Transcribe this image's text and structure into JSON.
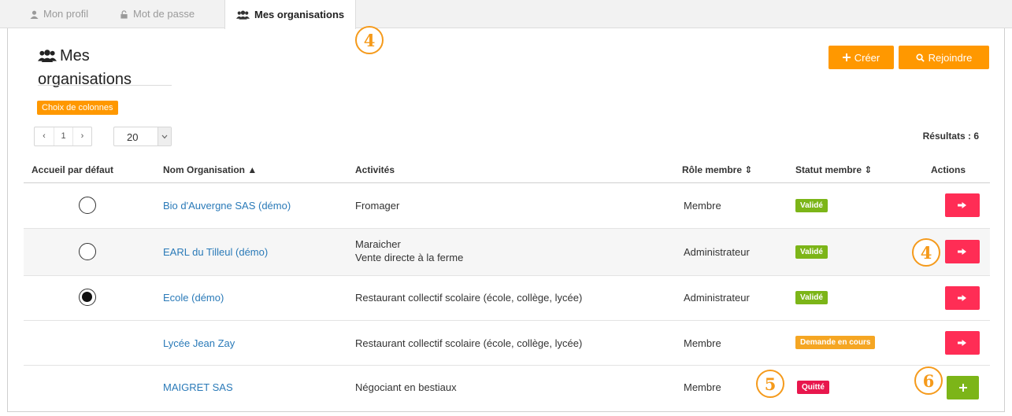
{
  "tabs": [
    {
      "label": "Mon profil",
      "icon": "user-icon",
      "active": false
    },
    {
      "label": "Mot de passe",
      "icon": "lock-icon",
      "active": false
    },
    {
      "label": "Mes organisations",
      "icon": "users-icon",
      "active": true
    }
  ],
  "page": {
    "title_line1": "Mes",
    "title_line2": "organisations",
    "create_label": "Créer",
    "join_label": "Rejoindre",
    "columns_label": "Choix de colonnes"
  },
  "pagination": {
    "prev": "‹",
    "current": "1",
    "next": "›",
    "page_size": "20",
    "results": "Résultats : 6"
  },
  "table": {
    "headers": {
      "default_home": "Accueil par défaut",
      "name": "Nom Organisation ▲",
      "activities": "Activités",
      "role": "Rôle membre ⇕",
      "status": "Statut membre ⇕",
      "actions": "Actions"
    },
    "rows": [
      {
        "name": "Bio d'Auvergne SAS (démo)",
        "activity1": "Fromager",
        "activity2": "",
        "role": "Membre",
        "status": "Validé",
        "status_color": "#7cb518",
        "has_radio": true,
        "radio_selected": false,
        "action": "leave"
      },
      {
        "name": "EARL du Tilleul (démo)",
        "activity1": "Maraicher",
        "activity2": "Vente directe à la ferme",
        "role": "Administrateur",
        "status": "Validé",
        "status_color": "#7cb518",
        "has_radio": true,
        "radio_selected": false,
        "action": "leave"
      },
      {
        "name": "Ecole (démo)",
        "activity1": "Restaurant collectif scolaire (école, collège, lycée)",
        "activity2": "",
        "role": "Administrateur",
        "status": "Validé",
        "status_color": "#7cb518",
        "has_radio": true,
        "radio_selected": true,
        "action": "leave"
      },
      {
        "name": "Lycée Jean Zay",
        "activity1": "Restaurant collectif scolaire (école, collège, lycée)",
        "activity2": "",
        "role": "Membre",
        "status": "Demande en cours",
        "status_color": "#f5a623",
        "has_radio": false,
        "radio_selected": false,
        "action": "leave"
      },
      {
        "name": "MAIGRET SAS",
        "activity1": "Négociant en bestiaux",
        "activity2": "",
        "role": "Membre",
        "status": "Quitté",
        "status_color": "#e8174d",
        "has_radio": false,
        "radio_selected": false,
        "action": "add"
      }
    ]
  },
  "annotations": {
    "tab_marker": "4",
    "row_action_marker": "4",
    "status_marker": "5",
    "add_marker": "6"
  },
  "colors": {
    "accent_orange": "#ff9800",
    "leave_red": "#ff2d55",
    "link_blue": "#2a7ab8",
    "annotation_orange": "#f59a1b"
  }
}
